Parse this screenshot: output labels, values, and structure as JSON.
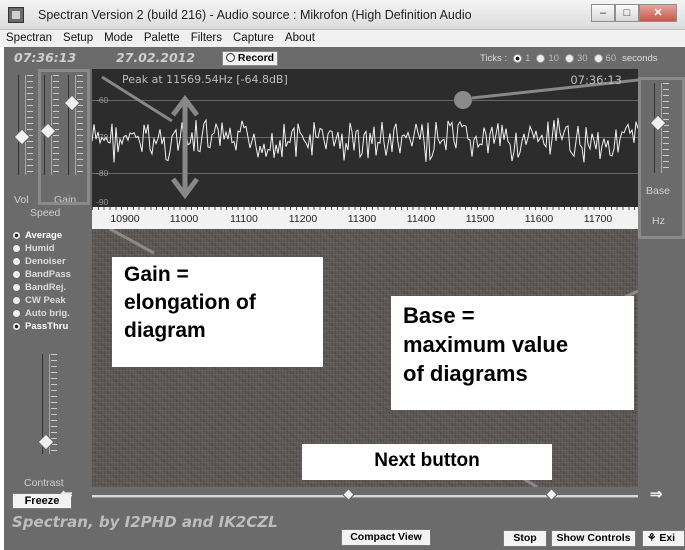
{
  "window": {
    "title": "Spectran Version 2 (build 216) - Audio source  :  Mikrofon (High Definition Audio",
    "minimize": "–",
    "maximize": "□",
    "close": "✕"
  },
  "menu": [
    "Spectran",
    "Setup",
    "Mode",
    "Palette",
    "Filters",
    "Capture",
    "About"
  ],
  "topbar": {
    "time": "07:36:13",
    "date": "27.02.2012",
    "record_label": "Record",
    "ticks_label": "Ticks :",
    "tick_options": [
      "1",
      "10",
      "30",
      "60"
    ],
    "tick_selected": "1",
    "seconds_label": "seconds"
  },
  "left_panel": {
    "vol_label": "Vol",
    "gain_label": "Gain",
    "speed_label": "Speed",
    "filters": [
      {
        "label": "Average",
        "selected": true,
        "bright": true
      },
      {
        "label": "Humid",
        "selected": false,
        "bright": false
      },
      {
        "label": "Denoiser",
        "selected": false,
        "bright": false
      },
      {
        "label": "BandPass",
        "selected": false,
        "bright": false
      },
      {
        "label": "BandRej.",
        "selected": false,
        "bright": false
      },
      {
        "label": "CW Peak",
        "selected": false,
        "bright": false
      },
      {
        "label": "Auto brig.",
        "selected": false,
        "bright": false
      },
      {
        "label": "PassThru",
        "selected": true,
        "bright": true
      }
    ],
    "contrast_label": "Contrast",
    "freeze_label": "Freeze"
  },
  "graph": {
    "peak_text": "Peak at 11569.54Hz [-64.8dB]",
    "clock": "07:36:13",
    "db_labels": [
      "-60",
      "-70",
      "-80",
      "-90"
    ],
    "freq_labels": [
      "10900",
      "11000",
      "11100",
      "11200",
      "11300",
      "11400",
      "11500",
      "11600",
      "11700"
    ]
  },
  "right_panel": {
    "base_label": "Base",
    "hz_label": "Hz"
  },
  "bottom": {
    "credit": "Spectran, by I2PHD and IK2CZL",
    "compact_view": "Compact View",
    "stop": "Stop",
    "show_controls": "Show Controls",
    "exit": "Exi"
  },
  "annotations": {
    "gain": [
      "Gain =",
      "elongation of",
      "diagram"
    ],
    "base": [
      "Base =",
      "maximum value",
      "of diagrams"
    ],
    "next": "Next button"
  },
  "colors": {
    "panel": "#6b6b6b",
    "graph_bg": "#2c2c2c",
    "annotation_arrow": "#8a8a8a"
  }
}
